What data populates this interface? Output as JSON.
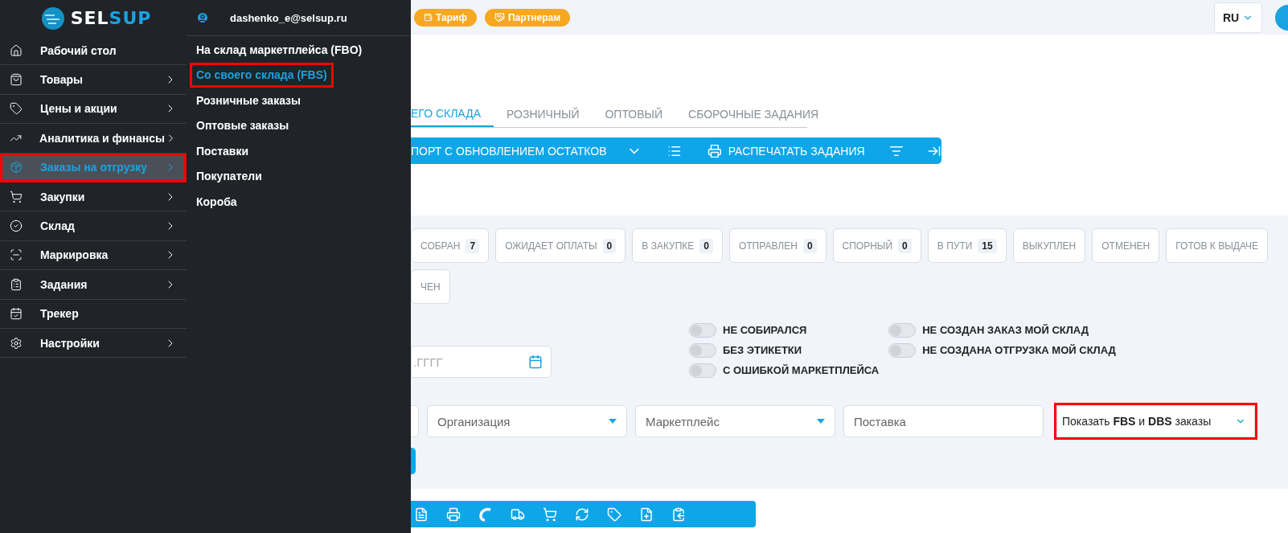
{
  "sidebar": {
    "logo": {
      "part_1": "SEL",
      "part_2": "SUP"
    },
    "items": [
      {
        "kind": "home",
        "label": "Рабочий стол",
        "has_arrow": false,
        "selected": false,
        "highlighted": false
      },
      {
        "kind": "bag",
        "label": "Товары",
        "has_arrow": true,
        "selected": false,
        "highlighted": false
      },
      {
        "kind": "tag",
        "label": "Цены и акции",
        "has_arrow": true,
        "selected": false,
        "highlighted": false
      },
      {
        "kind": "chart",
        "label": "Аналитика и финансы",
        "has_arrow": true,
        "selected": false,
        "highlighted": false
      },
      {
        "kind": "orders",
        "label": "Заказы на отгрузку",
        "has_arrow": true,
        "selected": true,
        "highlighted": true
      },
      {
        "kind": "cart",
        "label": "Закупки",
        "has_arrow": true,
        "selected": false,
        "highlighted": false
      },
      {
        "kind": "check",
        "label": "Склад",
        "has_arrow": true,
        "selected": false,
        "highlighted": false
      },
      {
        "kind": "scan",
        "label": "Маркировка",
        "has_arrow": true,
        "selected": false,
        "highlighted": false
      },
      {
        "kind": "tasks",
        "label": "Задания",
        "has_arrow": true,
        "selected": false,
        "highlighted": false
      },
      {
        "kind": "tracker",
        "label": "Трекер",
        "has_arrow": false,
        "selected": false,
        "highlighted": false
      },
      {
        "kind": "settings",
        "label": "Настройки",
        "has_arrow": true,
        "selected": false,
        "highlighted": false
      }
    ]
  },
  "submenu": {
    "user": "dashenko_e@selsup.ru",
    "items": [
      {
        "label": "На склад маркетплейса (FBO)",
        "selected": false,
        "highlighted": false
      },
      {
        "label": "Со своего склада (FBS)",
        "selected": true,
        "highlighted": true
      },
      {
        "label": "Розничные заказы",
        "selected": false,
        "highlighted": false
      },
      {
        "label": "Оптовые заказы",
        "selected": false,
        "highlighted": false
      },
      {
        "label": "Поставки",
        "selected": false,
        "highlighted": false
      },
      {
        "label": "Покупатели",
        "selected": false,
        "highlighted": false
      },
      {
        "label": "Короба",
        "selected": false,
        "highlighted": false
      }
    ]
  },
  "top_bar": {
    "badges": [
      "Тариф",
      "Партнерам"
    ],
    "language": "RU"
  },
  "tabs": [
    {
      "label": "ЕГО СКЛАДА",
      "selected": true
    },
    {
      "label": "РОЗНИЧНЫЙ",
      "selected": false
    },
    {
      "label": "ОПТОВЫЙ",
      "selected": false
    },
    {
      "label": "СБОРОЧНЫЕ ЗАДАНИЯ",
      "selected": false
    }
  ],
  "toolbar": {
    "export_label": "ПОРТ С ОБНОВЛЕНИЕМ ОСТАТКОВ",
    "print_label": "РАСПЕЧАТАТЬ ЗАДАНИЯ"
  },
  "status_chip_rows": [
    [
      {
        "label": "СОБРАН",
        "count": "7"
      },
      {
        "label": "ОЖИДАЕТ ОПЛАТЫ",
        "count": "0"
      },
      {
        "label": "В ЗАКУПКЕ",
        "count": "0"
      },
      {
        "label": "ОТПРАВЛЕН",
        "count": "0"
      },
      {
        "label": "СПОРНЫЙ",
        "count": "0"
      },
      {
        "label": "В ПУТИ",
        "count": "15"
      },
      {
        "label": "ВЫКУПЛЕН"
      },
      {
        "label": "ОТМЕНЕН"
      },
      {
        "label": "ГОТОВ К ВЫДАЧЕ"
      }
    ],
    [
      {
        "label": "ЧЕН"
      }
    ]
  ],
  "date_field": {
    "placeholder": ".ГГГГ"
  },
  "toggle_columns": [
    [
      {
        "label": "НЕ СОБИРАЛСЯ",
        "on": false
      },
      {
        "label": "БЕЗ ЭТИКЕТКИ",
        "on": false
      },
      {
        "label": "С ОШИБКОЙ МАРКЕТПЛЕЙСА",
        "on": false
      }
    ],
    [
      {
        "label": "НЕ СОЗДАН ЗАКАЗ МОЙ СКЛАД",
        "on": false
      },
      {
        "label": "НЕ СОЗДАНА ОТГРУЗКА МОЙ СКЛАД",
        "on": false
      }
    ]
  ],
  "filters": [
    {
      "kind": "select",
      "placeholder": "Организация"
    },
    {
      "kind": "select",
      "placeholder": "Маркетплейс"
    },
    {
      "kind": "input",
      "placeholder": "Поставка"
    }
  ],
  "order_type": {
    "value": "Показать **FBS** и **DBS** заказы",
    "highlighted": true
  }
}
